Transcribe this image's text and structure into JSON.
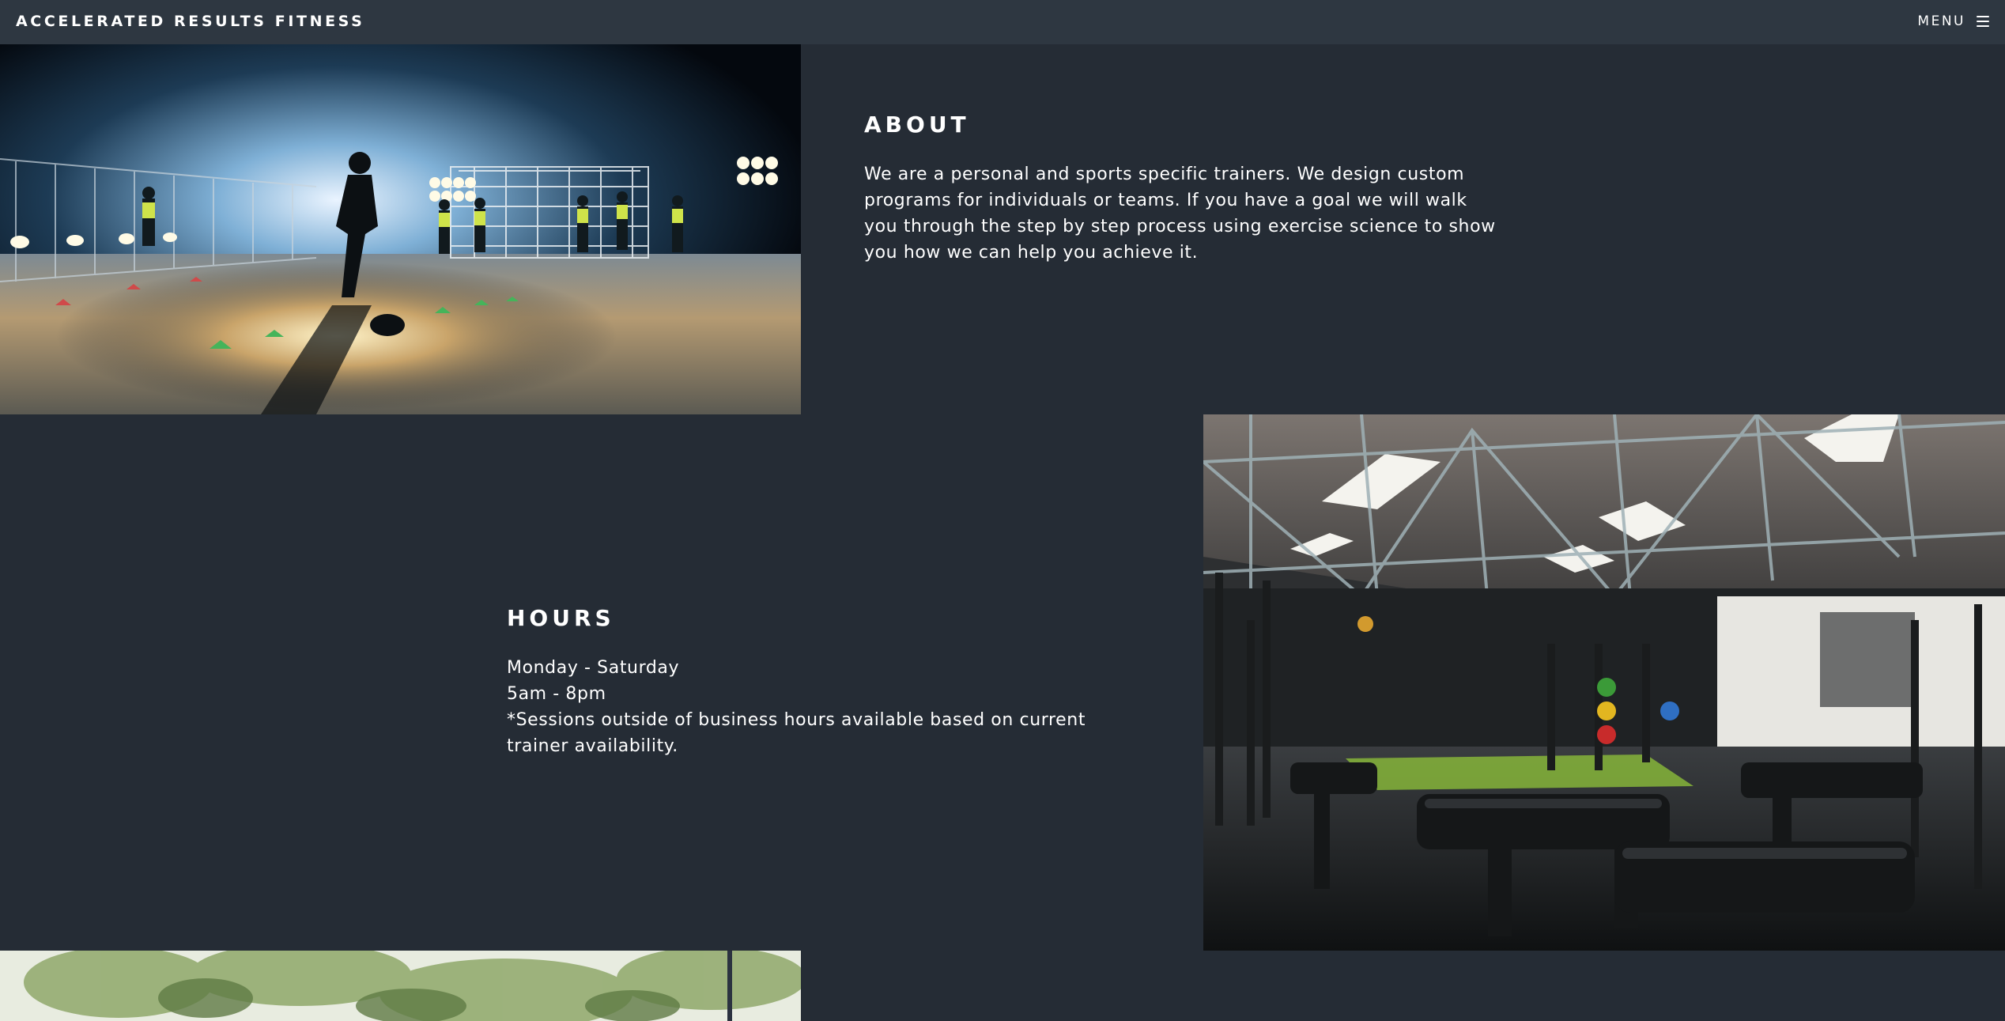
{
  "header": {
    "brand": "ACCELERATED RESULTS FITNESS",
    "menu_label": "MENU",
    "menu_icon": "hamburger-icon"
  },
  "about": {
    "title": "ABOUT",
    "body": "We are a personal and sports specific trainers. We design custom programs for individuals or teams. If you have a goal we will walk you through the step by step process using exercise science to show you how we can help you achieve it.",
    "image": "soccer-training-night-photo"
  },
  "hours": {
    "title": "HOURS",
    "lines": [
      "Monday - Saturday",
      "5am - 8pm",
      "*Sessions outside of business hours available based on current trainer availability."
    ],
    "image": "gym-interior-photo"
  },
  "third_section": {
    "image": "outdoor-trees-photo"
  },
  "colors": {
    "page_background": "#252c35",
    "header_background": "#2e3741",
    "text": "#ffffff"
  }
}
